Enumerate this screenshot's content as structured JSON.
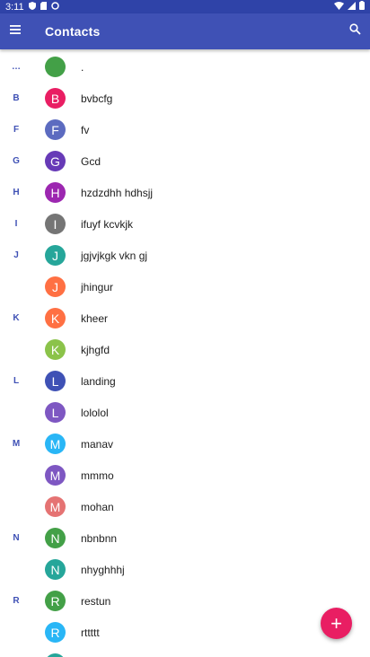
{
  "status_bar": {
    "time": "3:11"
  },
  "app_bar": {
    "title": "Contacts"
  },
  "contacts": [
    {
      "section": "…",
      "initial": "",
      "name": ".",
      "color": "#43a047"
    },
    {
      "section": "B",
      "initial": "B",
      "name": "bvbcfg",
      "color": "#e91e63"
    },
    {
      "section": "F",
      "initial": "F",
      "name": "fv",
      "color": "#5c6bc0"
    },
    {
      "section": "G",
      "initial": "G",
      "name": "Gcd",
      "color": "#673ab7"
    },
    {
      "section": "H",
      "initial": "H",
      "name": "hzdzdhh hdhsjj",
      "color": "#9c27b0"
    },
    {
      "section": "I",
      "initial": "I",
      "name": "ifuyf kcvkjk",
      "color": "#757575"
    },
    {
      "section": "J",
      "initial": "J",
      "name": "jgjvjkgk vkn gj",
      "color": "#26a69a"
    },
    {
      "section": "",
      "initial": "J",
      "name": "jhingur",
      "color": "#ff7043"
    },
    {
      "section": "K",
      "initial": "K",
      "name": "kheer",
      "color": "#ff7043"
    },
    {
      "section": "",
      "initial": "K",
      "name": "kjhgfd",
      "color": "#8bc34a"
    },
    {
      "section": "L",
      "initial": "L",
      "name": "landing",
      "color": "#3f51b5"
    },
    {
      "section": "",
      "initial": "L",
      "name": "lololol",
      "color": "#7e57c2"
    },
    {
      "section": "M",
      "initial": "M",
      "name": "manav",
      "color": "#29b6f6"
    },
    {
      "section": "",
      "initial": "M",
      "name": "mmmo",
      "color": "#7e57c2"
    },
    {
      "section": "",
      "initial": "M",
      "name": "mohan",
      "color": "#e57373"
    },
    {
      "section": "N",
      "initial": "N",
      "name": "nbnbnn",
      "color": "#43a047"
    },
    {
      "section": "",
      "initial": "N",
      "name": "nhyghhhj",
      "color": "#26a69a"
    },
    {
      "section": "R",
      "initial": "R",
      "name": "restun",
      "color": "#43a047"
    },
    {
      "section": "",
      "initial": "R",
      "name": "rttttt",
      "color": "#29b6f6"
    },
    {
      "section": "",
      "initial": "",
      "name": "",
      "color": "#26a69a"
    }
  ],
  "fab": {
    "label": "+"
  },
  "icons": {
    "menu": "menu-icon",
    "search": "search-icon",
    "add": "add-icon"
  }
}
